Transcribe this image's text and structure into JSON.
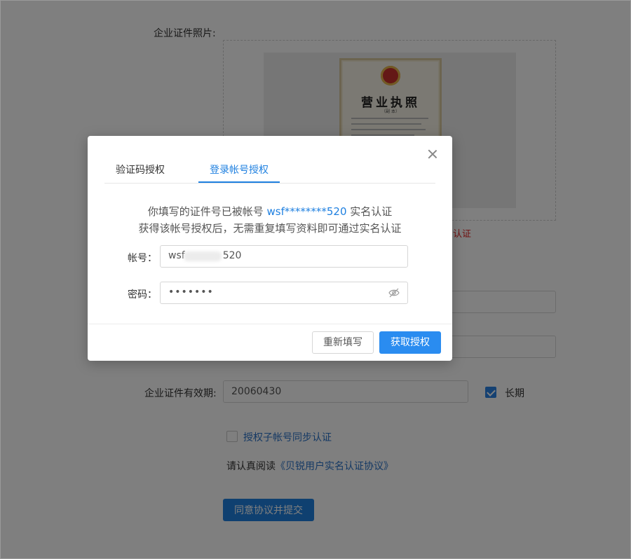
{
  "form": {
    "photo_label": "企业证件照片:",
    "license": {
      "title": "营业执照",
      "subtitle": "（副 本）"
    },
    "error_text": "名认证",
    "validity_label": "企业证件有效期:",
    "validity_value": "20060430",
    "long_term_label": "长期",
    "long_term_checked": true,
    "sync_label": "授权子帐号同步认证",
    "sync_checked": false,
    "agreement_prefix": "请认真阅读",
    "agreement_link": "《贝锐用户实名认证协议》",
    "submit_label": "同意协议并提交"
  },
  "modal": {
    "tabs": [
      {
        "label": "验证码授权",
        "active": false
      },
      {
        "label": "登录帐号授权",
        "active": true
      }
    ],
    "message_line1_prefix": "你填写的证件号已被帐号",
    "message_account": "wsf********520",
    "message_line1_suffix": "实名认证",
    "message_line2": "获得该帐号授权后，无需重复填写资料即可通过实名认证",
    "account_label": "帐号：",
    "account_prefix": "wsf",
    "account_suffix": "520",
    "password_label": "密码：",
    "password_value": "•••••••",
    "reset_label": "重新填写",
    "confirm_label": "获取授权",
    "colors": {
      "accent": "#1f80e0",
      "error": "#e02020"
    }
  }
}
